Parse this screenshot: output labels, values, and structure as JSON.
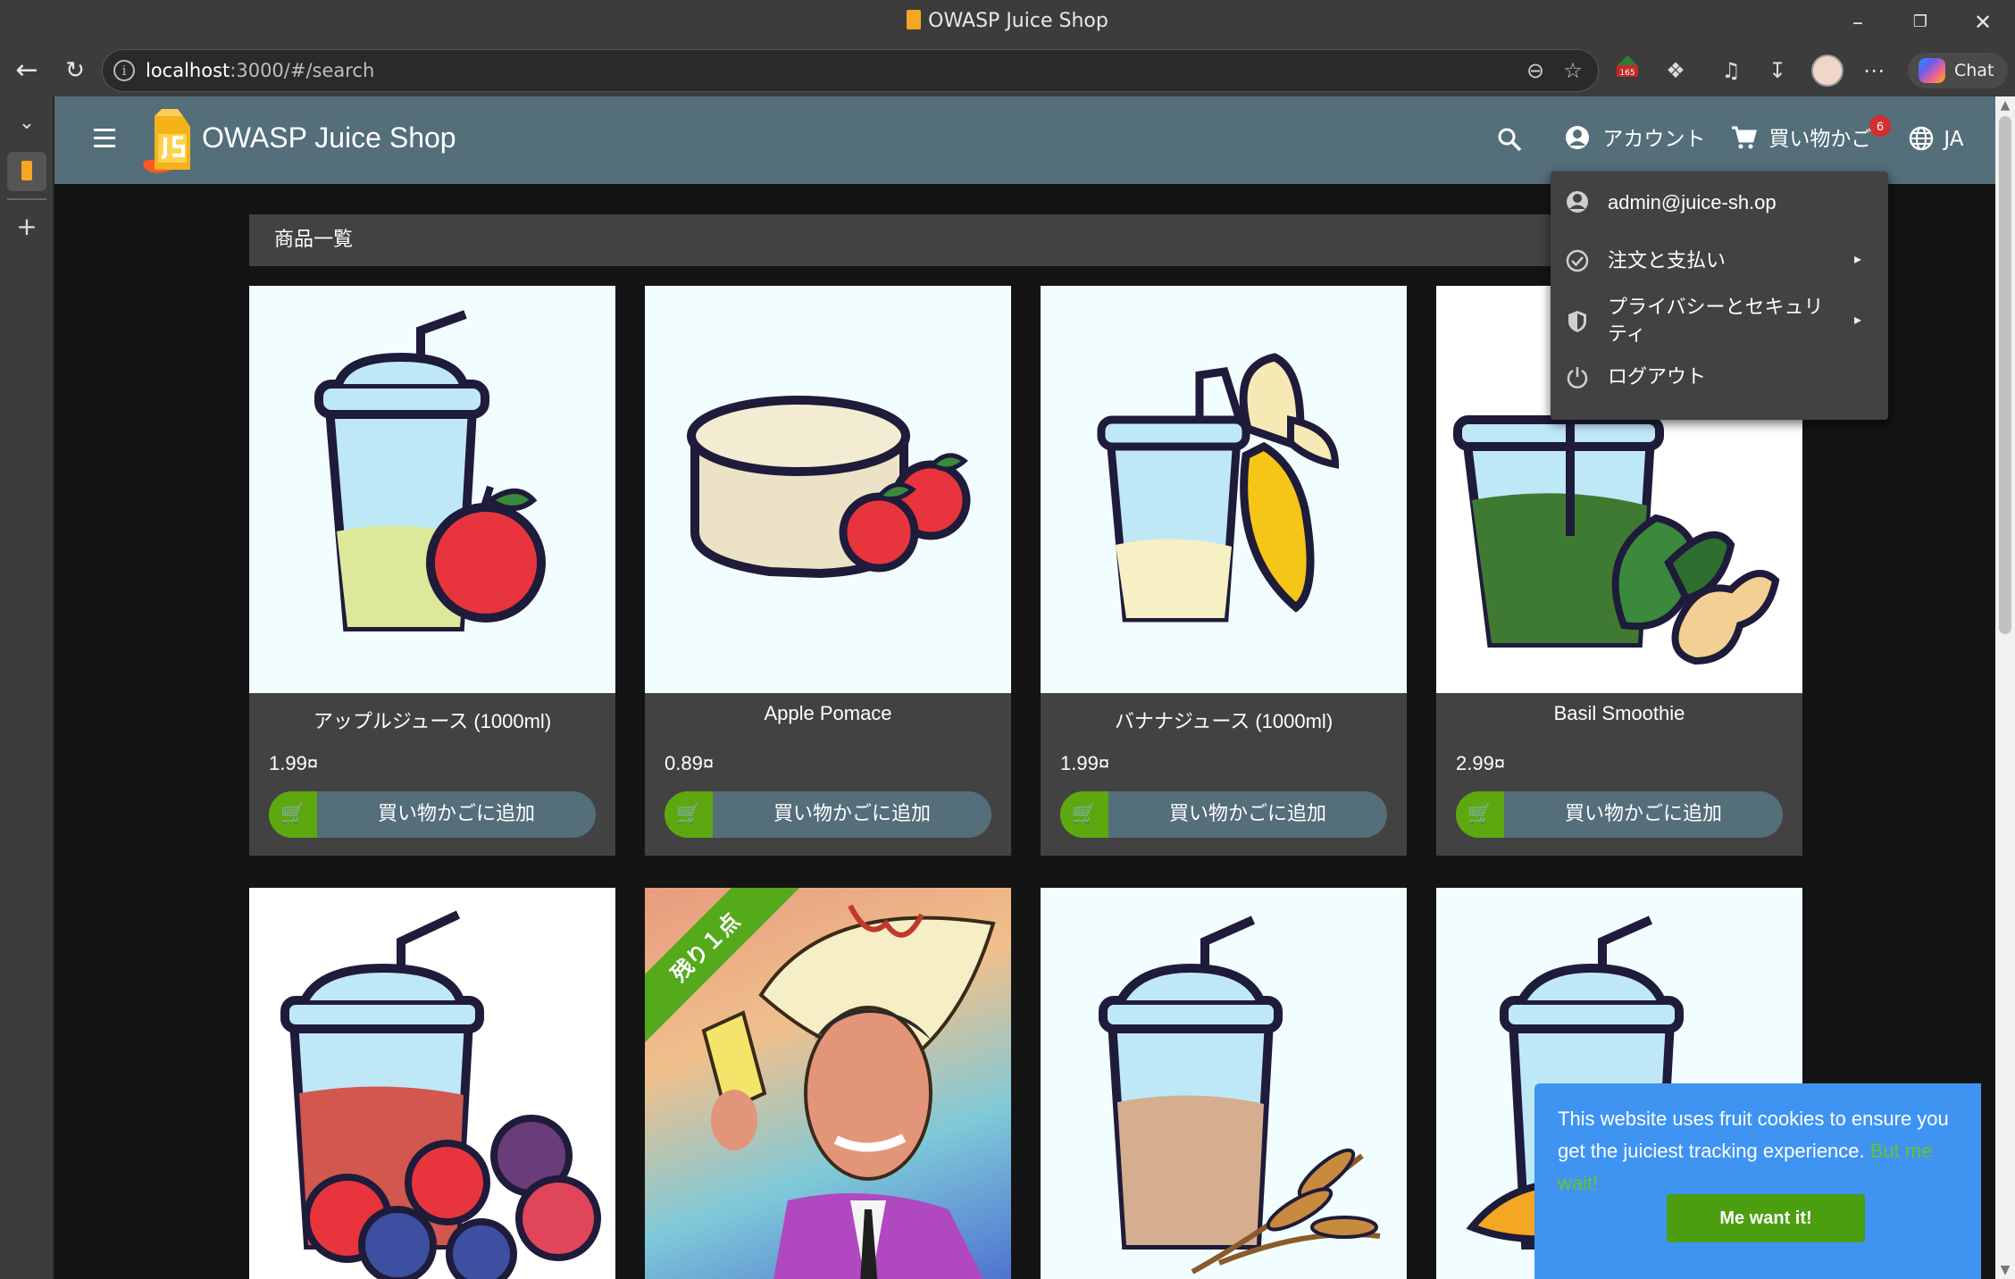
{
  "browser": {
    "window_title": "OWASP Juice Shop",
    "url_host": "localhost",
    "url_rest": ":3000/#/search",
    "ext_badge": "165",
    "chat_label": "Chat"
  },
  "app": {
    "title": "OWASP Juice Shop",
    "account_label": "アカウント",
    "basket_label": "買い物かご",
    "basket_count": "6",
    "language": "JA",
    "section_title": "商品一覧"
  },
  "account_menu": {
    "email": "admin@juice-sh.op",
    "orders_label": "注文と支払い",
    "privacy_label": "プライバシーとセキュリティ",
    "logout_label": "ログアウト"
  },
  "products": [
    {
      "name": "アップルジュース (1000ml)",
      "price": "1.99¤",
      "button": "買い物かごに追加"
    },
    {
      "name": "Apple Pomace",
      "price": "0.89¤",
      "button": "買い物かごに追加"
    },
    {
      "name": "バナナジュース (1000ml)",
      "price": "1.99¤",
      "button": "買い物かごに追加"
    },
    {
      "name": "Basil Smoothie",
      "price": "2.99¤",
      "button": "買い物かごに追加"
    }
  ],
  "ribbon_label": "残り１点",
  "cookie": {
    "message": "This website uses fruit cookies to ensure you get the juiciest tracking experience.",
    "link": "But me wait!",
    "button": "Me want it!"
  },
  "colors": {
    "toolbar": "#546e7a",
    "card": "#424242",
    "cart_green": "#5ea80f",
    "cookie_blue": "#3f94f2",
    "badge_red": "#d32f2f"
  }
}
